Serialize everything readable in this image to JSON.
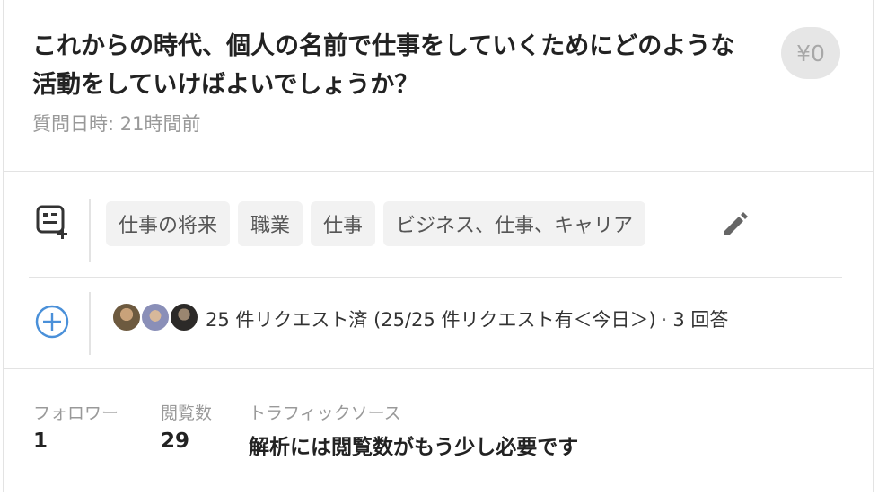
{
  "question": {
    "title": "これからの時代、個人の名前で仕事をしていくためにどのような活動をしていけばよいでしょうか？",
    "price": "¥0",
    "asked_label": "質問日時: ",
    "asked_value": "21時間前"
  },
  "tags": [
    "仕事の将来",
    "職業",
    "仕事",
    "ビジネス、仕事、キャリア"
  ],
  "requests": {
    "text": "25 件リクエスト済 (25/25 件リクエスト有＜今日＞)",
    "separator": "·",
    "answers": "3 回答"
  },
  "stats": [
    {
      "label": "フォロワー",
      "value": "1"
    },
    {
      "label": "閲覧数",
      "value": "29"
    },
    {
      "label": "トラフィックソース",
      "value": "解析には閲覧数がもう少し必要です"
    }
  ],
  "colors": {
    "accent": "#4a90d9",
    "muted": "#999999",
    "tag_bg": "#f2f2f2"
  },
  "icons": {
    "tag": "tag-add-icon",
    "edit": "pencil-icon",
    "request": "plus-circle-icon"
  }
}
